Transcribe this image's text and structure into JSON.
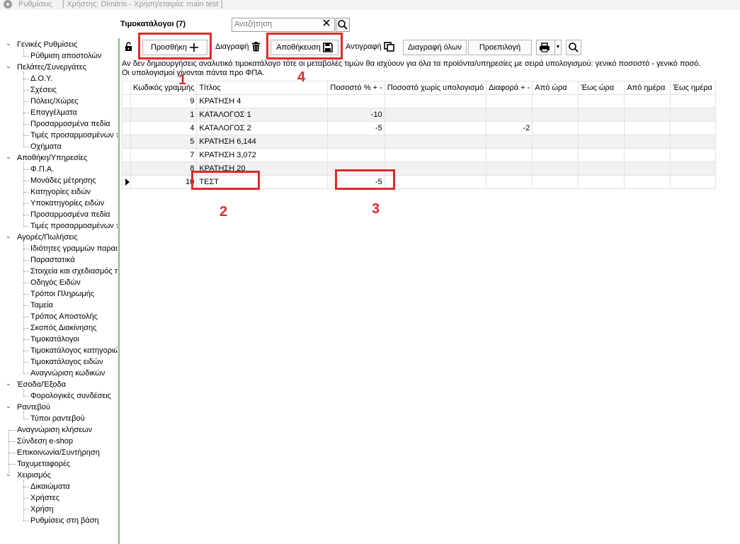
{
  "window": {
    "app_title": "Ρυθμίσεις",
    "session": "[ Χρήστης: Dimitris - Χρήση/εταιρία: main test ]"
  },
  "header": {
    "title": "Τιμοκατάλογοι (7)",
    "search_placeholder": "Αναζήτηση"
  },
  "toolbar": {
    "add": "Προσθήκη",
    "delete": "Διαγραφή",
    "save": "Αποθήκευση",
    "copy": "Αντιγραφή",
    "delete_all": "Διαγραφή όλων",
    "default": "Προεπιλογή"
  },
  "info": {
    "line1": "Αν δεν δημιουργήσεις αναλυτικό τιμοκατάλογο τότε οι μεταβολές τιμών θα ισχύουν για όλα τα προϊόντα/υπηρεσίες με σειρά υπολογισμού: γενικό ποσοστό - γενικό ποσό.",
    "line2": "Οι υπολογισμοί γίνονται πάντα προ ΦΠΑ."
  },
  "grid": {
    "headers": [
      "Κωδικός γραμμής",
      "Τίτλος",
      "Ποσοστό % + -",
      "Ποσοστό χωρίς υπολογισμό",
      "Διαφορά + -",
      "Από ώρα",
      "Έως ώρα",
      "Από ημέρα",
      "Έως ημέρα"
    ],
    "rows": [
      {
        "code": "9",
        "title": "ΚΡΑΤΗΣΗ 4",
        "pct": "",
        "pct_nocalc": "",
        "diff": "",
        "from_time": "",
        "to_time": "",
        "from_day": "",
        "to_day": ""
      },
      {
        "code": "1",
        "title": "ΚΑΤΑΛΟΓΟΣ 1",
        "pct": "-10",
        "pct_nocalc": "",
        "diff": "",
        "from_time": "",
        "to_time": "",
        "from_day": "",
        "to_day": ""
      },
      {
        "code": "4",
        "title": "ΚΑΤΑΛΟΓΟΣ 2",
        "pct": "-5",
        "pct_nocalc": "",
        "diff": "-2",
        "from_time": "",
        "to_time": "",
        "from_day": "",
        "to_day": ""
      },
      {
        "code": "5",
        "title": "ΚΡΑΤΗΣΗ 6,144",
        "pct": "",
        "pct_nocalc": "",
        "diff": "",
        "from_time": "",
        "to_time": "",
        "from_day": "",
        "to_day": ""
      },
      {
        "code": "7",
        "title": "ΚΡΑΤΗΣΗ 3,072",
        "pct": "",
        "pct_nocalc": "",
        "diff": "",
        "from_time": "",
        "to_time": "",
        "from_day": "",
        "to_day": ""
      },
      {
        "code": "8",
        "title": "ΚΡΑΤΗΣΗ 20",
        "pct": "",
        "pct_nocalc": "",
        "diff": "",
        "from_time": "",
        "to_time": "",
        "from_day": "",
        "to_day": ""
      },
      {
        "code": "10",
        "title": "ΤΕΣΤ",
        "pct": "-5",
        "pct_nocalc": "",
        "diff": "",
        "from_time": "",
        "to_time": "",
        "from_day": "",
        "to_day": ""
      }
    ]
  },
  "sidebar": {
    "items": [
      {
        "label": "Γενικές Ρυθμίσεις",
        "level": 0,
        "expanded": true
      },
      {
        "label": "Ρύθμιση αποστολών",
        "level": 1
      },
      {
        "label": "Πελάτες/Συνεργάτες",
        "level": 0,
        "expanded": true
      },
      {
        "label": "Δ.Ο.Υ.",
        "level": 1
      },
      {
        "label": "Σχέσεις",
        "level": 1
      },
      {
        "label": "Πόλεις/Χώρες",
        "level": 1
      },
      {
        "label": "Επαγγέλματα",
        "level": 1
      },
      {
        "label": "Προσαρμοσμένα πεδία",
        "level": 1
      },
      {
        "label": "Τιμές προσαρμοσμένων πεδίων",
        "level": 1
      },
      {
        "label": "Οχήματα",
        "level": 1
      },
      {
        "label": "Αποθήκη/Υπηρεσίες",
        "level": 0,
        "expanded": true
      },
      {
        "label": "Φ.Π.Α.",
        "level": 1
      },
      {
        "label": "Μονάδες μέτρησης",
        "level": 1
      },
      {
        "label": "Κατηγορίες ειδών",
        "level": 1
      },
      {
        "label": "Υποκατηγορίες ειδών",
        "level": 1
      },
      {
        "label": "Προσαρμοσμένα πεδία",
        "level": 1
      },
      {
        "label": "Τιμές προσαρμοσμένων πεδίων",
        "level": 1
      },
      {
        "label": "Αγορές/Πωλήσεις",
        "level": 0,
        "expanded": true
      },
      {
        "label": "Ιδιότητες γραμμών παραστατικών",
        "level": 1
      },
      {
        "label": "Παραστατικά",
        "level": 1
      },
      {
        "label": "Στοιχεία και σχεδιασμός παραστατικών",
        "level": 1
      },
      {
        "label": "Οδηγός Ειδών",
        "level": 1
      },
      {
        "label": "Τρόποι Πληρωμής",
        "level": 1
      },
      {
        "label": "Ταμεία",
        "level": 1
      },
      {
        "label": "Τρόπος Αποστολής",
        "level": 1
      },
      {
        "label": "Σκοπός Διακίνησης",
        "level": 1
      },
      {
        "label": "Τιμοκατάλογοι",
        "level": 1
      },
      {
        "label": "Τιμοκατάλογος κατηγοριών",
        "level": 1
      },
      {
        "label": "Τιμοκατάλογος ειδών",
        "level": 1
      },
      {
        "label": "Αναγνώριση κωδικών",
        "level": 1
      },
      {
        "label": "Έσοδα/Έξοδα",
        "level": 0,
        "expanded": true
      },
      {
        "label": "Φορολογικές συνδέσεις",
        "level": 1
      },
      {
        "label": "Ραντεβού",
        "level": 0,
        "expanded": true
      },
      {
        "label": "Τύποι ραντεβού",
        "level": 1
      },
      {
        "label": "Αναγνώριση κλήσεων",
        "level": 0
      },
      {
        "label": "Σύνδεση e-shop",
        "level": 0
      },
      {
        "label": "Επικοινωνία/Συντήρηση",
        "level": 0
      },
      {
        "label": "Ταχυμεταφορές",
        "level": 0
      },
      {
        "label": "Χειρισμός",
        "level": 0,
        "expanded": true
      },
      {
        "label": "Δικαιώματα",
        "level": 1
      },
      {
        "label": "Χρήστες",
        "level": 1
      },
      {
        "label": "Χρήση",
        "level": 1
      },
      {
        "label": "Ρυθμίσεις στη βάση",
        "level": 1
      }
    ]
  },
  "annotations": {
    "n1": "1",
    "n2": "2",
    "n3": "3",
    "n4": "4",
    "color": "#e02a2a"
  }
}
